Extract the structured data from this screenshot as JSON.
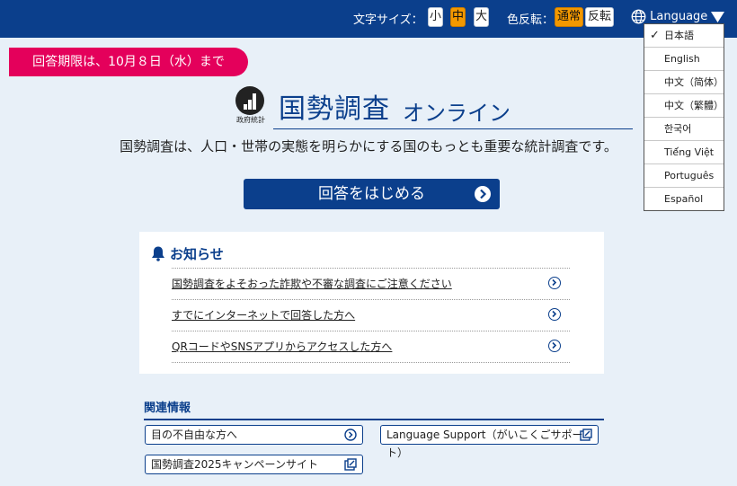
{
  "colors": {
    "header_bg": "#0b3f8c",
    "active_toggle": "#f39800",
    "deadline_bg": "#e4005b",
    "page_bg": "#e8f0f8"
  },
  "header": {
    "font_size_label": "文字サイズ：",
    "font_sizes": [
      "小",
      "中",
      "大"
    ],
    "font_size_selected": "中",
    "color_label": "色反転：",
    "color_modes": [
      "通常",
      "反転"
    ],
    "color_mode_selected": "通常",
    "language_label": "Language",
    "icons": [
      "globe-icon",
      "caret-down-icon"
    ]
  },
  "deadline": "回答期限は、10月８日（水）まで",
  "logo": {
    "caption": "政府統計",
    "icon": "statistics-logo-icon"
  },
  "title": {
    "main": "国勢調査",
    "sub": "オンライン"
  },
  "tagline": "国勢調査は、人口・世帯の実態を明らかにする国のもっとも重要な統計調査です。",
  "start_button": {
    "label": "回答をはじめる",
    "icon": "arrow-right-circle-icon"
  },
  "news": {
    "heading": "お知らせ",
    "icon": "bell-icon",
    "items": [
      "国勢調査をよそおった詐欺や不審な調査にご注意ください",
      "すでにインターネットで回答した方へ",
      "QRコードやSNSアプリからアクセスした方へ"
    ]
  },
  "related": {
    "heading": "関連情報",
    "links": [
      {
        "label": "目の不自由な方へ",
        "icon": "arrow-right-circle-icon"
      },
      {
        "label": "Language Support（がいこくごサポート）",
        "icon": "external-link-icon"
      },
      {
        "label": "国勢調査2025キャンペーンサイト",
        "icon": "external-link-icon"
      }
    ]
  },
  "language_menu": {
    "selected": "日本語",
    "options": [
      "日本語",
      "English",
      "中文（简体）",
      "中文（繁體）",
      "한국어",
      "Tiế́ng Việt",
      "Português",
      "Español"
    ]
  }
}
